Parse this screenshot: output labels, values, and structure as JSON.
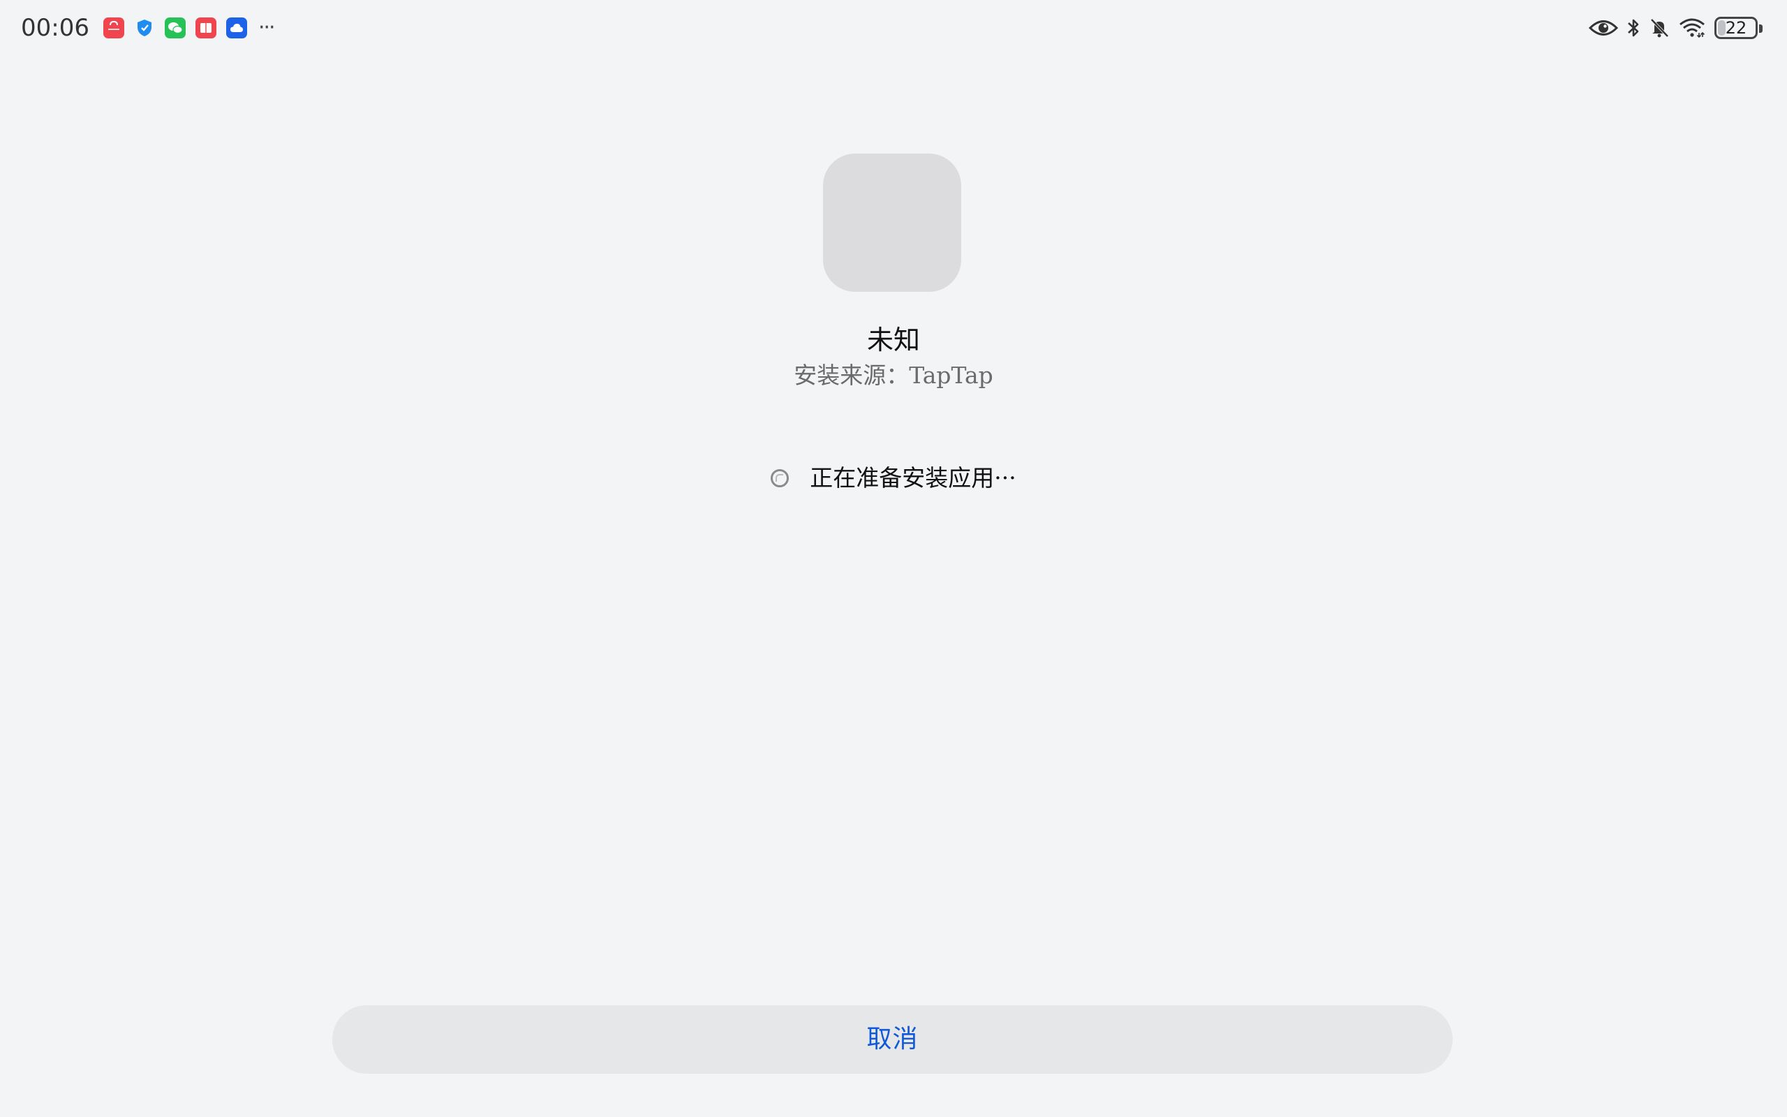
{
  "status_bar": {
    "time": "00:06",
    "notification_icons": [
      "app-store-icon",
      "shield-icon",
      "wechat-icon",
      "book-icon",
      "cloud-icon"
    ],
    "more_indicator": "···",
    "system_icons": [
      "eye-icon",
      "bluetooth-icon",
      "bell-muted-icon",
      "wifi-icon"
    ],
    "battery_level": "22",
    "battery_fraction": 0.22
  },
  "app": {
    "name": "未知",
    "install_source": "安装来源：TapTap"
  },
  "progress": {
    "status_text": "正在准备安装应用···"
  },
  "actions": {
    "cancel_label": "取消"
  },
  "colors": {
    "background": "#f3f4f6",
    "accent": "#1159d6",
    "icon_placeholder": "#dcdcde",
    "button_bg": "#e6e7e9"
  }
}
